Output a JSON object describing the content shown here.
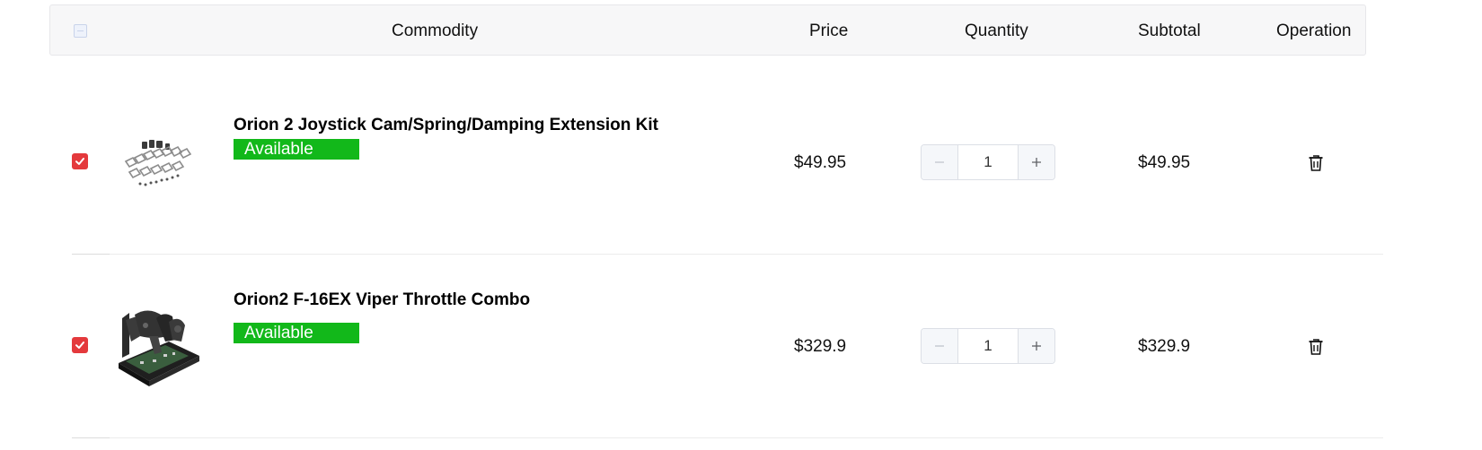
{
  "header": {
    "commodity": "Commodity",
    "price": "Price",
    "quantity": "Quantity",
    "subtotal": "Subtotal",
    "operation": "Operation"
  },
  "items": [
    {
      "title": "Orion 2 Joystick Cam/Spring/Damping Extension Kit",
      "badge": "Available Item",
      "price": "$49.95",
      "quantity": "1",
      "subtotal": "$49.95",
      "checked": true,
      "thumb_icon": "extension-kit-parts-image"
    },
    {
      "title": "Orion2 F-16EX Viper Throttle Combo",
      "badge": "Available Item",
      "price": "$329.9",
      "quantity": "1",
      "subtotal": "$329.9",
      "checked": true,
      "thumb_icon": "throttle-combo-image"
    }
  ],
  "colors": {
    "checkbox_checked": "#e4393c",
    "badge_bg": "#12b81a",
    "header_bg": "#f7f7f8"
  }
}
